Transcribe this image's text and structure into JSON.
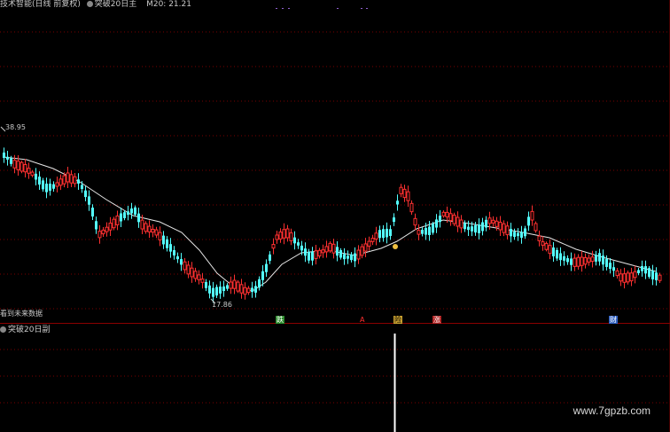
{
  "header": {
    "indicator": "技术智能(日线 前复权)",
    "sub_indicator": "突破20日主",
    "ma_label": "M20: 21.21"
  },
  "chart": {
    "high_label": "38.95",
    "low_label": "17.86",
    "future_note": "看到未来数据",
    "markers": [
      "跌",
      "A",
      "险",
      "涨",
      "财"
    ]
  },
  "sub_panel": {
    "title": "突破20日副"
  },
  "watermark": "www.7gpzb.com",
  "colors": {
    "up": "#ff3030",
    "down": "#54ffff",
    "ma": "#e6e6e6",
    "grid": "#7a0000",
    "text": "#c8c8c8"
  }
}
